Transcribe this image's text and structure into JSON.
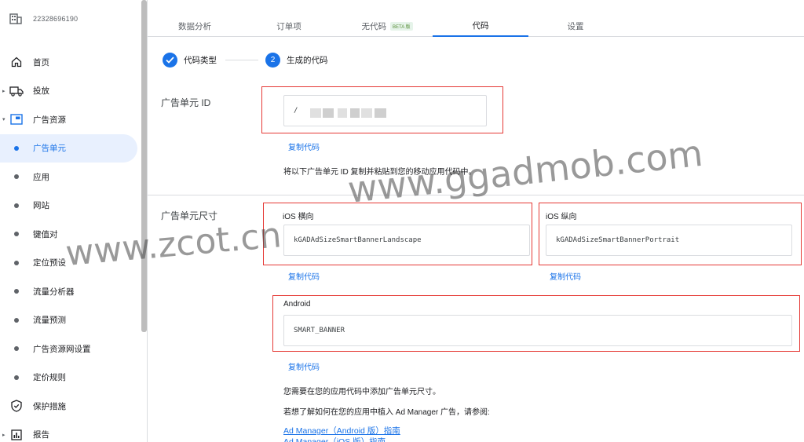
{
  "account": {
    "id": "22328696190"
  },
  "sidebar": {
    "items": [
      {
        "label": "首页",
        "icon": "home-icon",
        "kind": "icon"
      },
      {
        "label": "投放",
        "icon": "truck-icon",
        "kind": "icon-arrow"
      },
      {
        "label": "广告资源",
        "icon": "ad-unit-icon",
        "kind": "icon-arrow-open"
      },
      {
        "label": "广告单元",
        "kind": "dot",
        "active": true
      },
      {
        "label": "应用",
        "kind": "dot"
      },
      {
        "label": "网站",
        "kind": "dot"
      },
      {
        "label": "键值对",
        "kind": "dot"
      },
      {
        "label": "定位预设",
        "kind": "dot"
      },
      {
        "label": "流量分析器",
        "kind": "dot"
      },
      {
        "label": "流量预测",
        "kind": "dot"
      },
      {
        "label": "广告资源网设置",
        "kind": "dot"
      },
      {
        "label": "定价规则",
        "kind": "dot"
      },
      {
        "label": "保护措施",
        "icon": "shield-icon",
        "kind": "icon"
      },
      {
        "label": "报告",
        "icon": "report-chart-icon",
        "kind": "icon-arrow"
      }
    ]
  },
  "tabs": {
    "data_analysis": "数据分析",
    "order_items": "订单项",
    "no_code": "无代码",
    "beta": "BETA 版",
    "code": "代码",
    "settings": "设置"
  },
  "stepper": {
    "step1": "代码类型",
    "step2_num": "2",
    "step2": "生成的代码"
  },
  "ad_unit_id": {
    "label": "广告单元 ID",
    "value": "/",
    "copy": "复制代码",
    "hint": "将以下广告单元 ID 复制并粘贴到您的移动应用代码中。"
  },
  "ad_unit_size": {
    "label": "广告单元尺寸",
    "ios_landscape": {
      "label": "iOS 横向",
      "value": "kGADAdSizeSmartBannerLandscape",
      "copy": "复制代码"
    },
    "ios_portrait": {
      "label": "iOS 纵向",
      "value": "kGADAdSizeSmartBannerPortrait",
      "copy": "复制代码"
    },
    "android": {
      "label": "Android",
      "value": "SMART_BANNER",
      "copy": "复制代码"
    },
    "note1": "您需要在您的应用代码中添加广告单元尺寸。",
    "note2": "若想了解如何在您的应用中植入 Ad Manager 广告，请参阅:",
    "link_android": "Ad Manager（Android 版）指南",
    "link_ios": "Ad Manager（iOS 版）指南"
  },
  "watermarks": {
    "wm1": "www.zcot.cn",
    "wm2": "www.ggadmob.com"
  },
  "colors": {
    "accent": "#1a73e8",
    "highlight_box": "#e53935",
    "active_bg": "#e8f0fe"
  }
}
